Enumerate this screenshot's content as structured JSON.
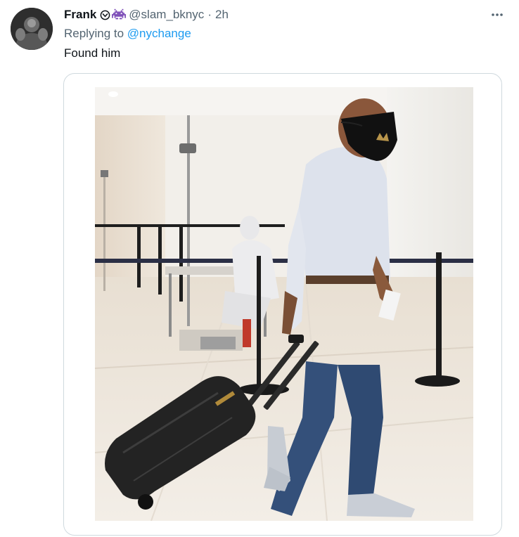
{
  "tweet": {
    "display_name": "Frank",
    "handle": "@slam_bknyc",
    "separator": "·",
    "time": "2h",
    "replying_to_label": "Replying to",
    "replying_to_mention": "@nychange",
    "text": "Found him"
  },
  "icons": {
    "verified_badge": "circle-chevron-badge-icon",
    "emoji_badge": "purple-space-invader-icon",
    "more": "more-horizontal-icon"
  },
  "colors": {
    "link": "#1d9bf0",
    "secondary_text": "#536471",
    "primary_text": "#0f1419",
    "card_border": "#cfd9de",
    "invader_purple": "#7b4ab6"
  }
}
